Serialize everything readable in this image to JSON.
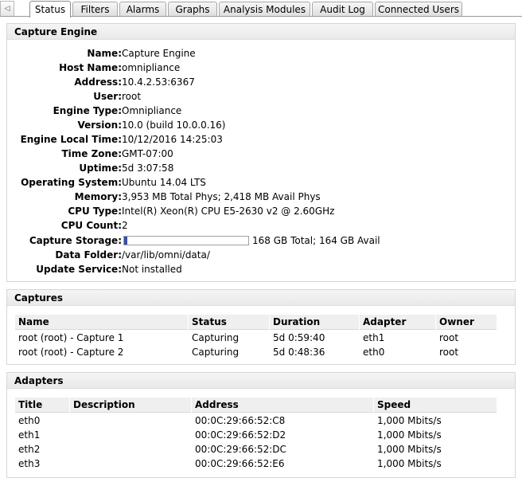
{
  "tabs": [
    {
      "label": "Status",
      "active": true
    },
    {
      "label": "Filters"
    },
    {
      "label": "Alarms"
    },
    {
      "label": "Graphs"
    },
    {
      "label": "Analysis Modules"
    },
    {
      "label": "Audit Log"
    },
    {
      "label": "Connected Users"
    }
  ],
  "scroll_left_glyph": "◁",
  "capture_engine": {
    "title": "Capture Engine",
    "fields": [
      {
        "label": "Name:",
        "value": "Capture Engine"
      },
      {
        "label": "Host Name:",
        "value": "omnipliance"
      },
      {
        "label": "Address:",
        "value": "10.4.2.53:6367"
      },
      {
        "label": "User:",
        "value": "root"
      },
      {
        "label": "Engine Type:",
        "value": "Omnipliance"
      },
      {
        "label": "Version:",
        "value": "10.0 (build 10.0.0.16)"
      },
      {
        "label": "Engine Local Time:",
        "value": "10/12/2016 14:25:03"
      },
      {
        "label": "Time Zone:",
        "value": "GMT-07:00"
      },
      {
        "label": "Uptime:",
        "value": "5d 3:07:58"
      },
      {
        "label": "Operating System:",
        "value": "Ubuntu 14.04 LTS"
      },
      {
        "label": "Memory:",
        "value": "3,953 MB Total Phys; 2,418 MB Avail Phys"
      },
      {
        "label": "CPU Type:",
        "value": "Intel(R) Xeon(R) CPU E5-2630 v2 @ 2.60GHz"
      },
      {
        "label": "CPU Count:",
        "value": "2"
      }
    ],
    "storage": {
      "label": "Capture Storage:",
      "text": "168 GB Total; 164 GB Avail",
      "used_fraction": 0.024
    },
    "fields_after": [
      {
        "label": "Data Folder:",
        "value": "/var/lib/omni/data/"
      },
      {
        "label": "Update Service:",
        "value": "Not installed"
      }
    ]
  },
  "captures": {
    "title": "Captures",
    "columns": [
      "Name",
      "Status",
      "Duration",
      "Adapter",
      "Owner"
    ],
    "rows": [
      [
        "root (root) - Capture 1",
        "Capturing",
        "5d 0:59:40",
        "eth1",
        "root"
      ],
      [
        "root (root) - Capture 2",
        "Capturing",
        "5d 0:48:36",
        "eth0",
        "root"
      ]
    ]
  },
  "adapters": {
    "title": "Adapters",
    "columns": [
      "Title",
      "Description",
      "Address",
      "Speed"
    ],
    "rows": [
      [
        "eth0",
        "",
        "00:0C:29:66:52:C8",
        "1,000 Mbits/s"
      ],
      [
        "eth1",
        "",
        "00:0C:29:66:52:D2",
        "1,000 Mbits/s"
      ],
      [
        "eth2",
        "",
        "00:0C:29:66:52:DC",
        "1,000 Mbits/s"
      ],
      [
        "eth3",
        "",
        "00:0C:29:66:52:E6",
        "1,000 Mbits/s"
      ]
    ]
  },
  "colors": {
    "storage_fill": "#3a4ea8",
    "panel_header": "#ececec"
  }
}
